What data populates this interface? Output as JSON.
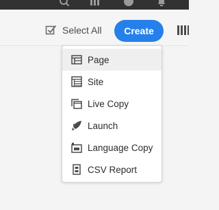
{
  "header": {
    "icons": [
      "search-icon",
      "apps-icon",
      "help-icon",
      "notifications-icon"
    ]
  },
  "toolbar": {
    "select_all_label": "Select All",
    "create_label": "Create",
    "view_switch_icon": "view-columns-icon"
  },
  "create_menu": {
    "items": [
      {
        "label": "Page",
        "icon": "page-icon",
        "highlighted": true
      },
      {
        "label": "Site",
        "icon": "site-icon",
        "highlighted": false
      },
      {
        "label": "Live Copy",
        "icon": "live-copy-icon",
        "highlighted": false
      },
      {
        "label": "Launch",
        "icon": "launch-icon",
        "highlighted": false
      },
      {
        "label": "Language Copy",
        "icon": "language-copy-icon",
        "highlighted": false
      },
      {
        "label": "CSV Report",
        "icon": "csv-report-icon",
        "highlighted": false
      }
    ]
  },
  "colors": {
    "accent": "#2680eb",
    "header": "#323232",
    "menu_highlight": "#efefef"
  }
}
